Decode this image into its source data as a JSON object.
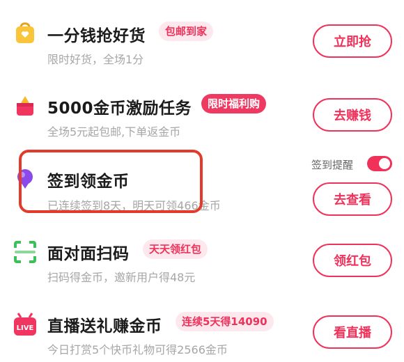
{
  "tasks": [
    {
      "title": "一分钱抢好货",
      "badge": "包邮到家",
      "subtitle": "限时好货，全场1分",
      "button": "立即抢",
      "icon": "shopping-bag-icon"
    },
    {
      "title": "5000金币激励任务",
      "badge": "限时福利购",
      "subtitle": "全场5元起包邮,下单返金币",
      "button": "去赚钱",
      "icon": "gift-box-icon"
    },
    {
      "title": "签到领金币",
      "subtitle": "已连续签到8天，明天可领466金币",
      "button": "去查看",
      "icon": "location-pin-icon",
      "remind_label": "签到提醒",
      "remind_on": true
    },
    {
      "title": "面对面扫码",
      "badge": "天天领红包",
      "subtitle": "扫码得金币，邀新用户得48元",
      "button": "领红包",
      "icon": "scan-icon"
    },
    {
      "title": "直播送礼赚金币",
      "badge": "连续5天得14090",
      "subtitle": "今日打赏5个快币礼物可得2566金币",
      "button": "看直播",
      "icon": "live-icon",
      "icon_text": "LIVE"
    }
  ],
  "colors": {
    "accent": "#f0325b",
    "highlight_border": "#e33b2b",
    "subtitle": "#a6a6a6",
    "title": "#1b1b1b"
  }
}
